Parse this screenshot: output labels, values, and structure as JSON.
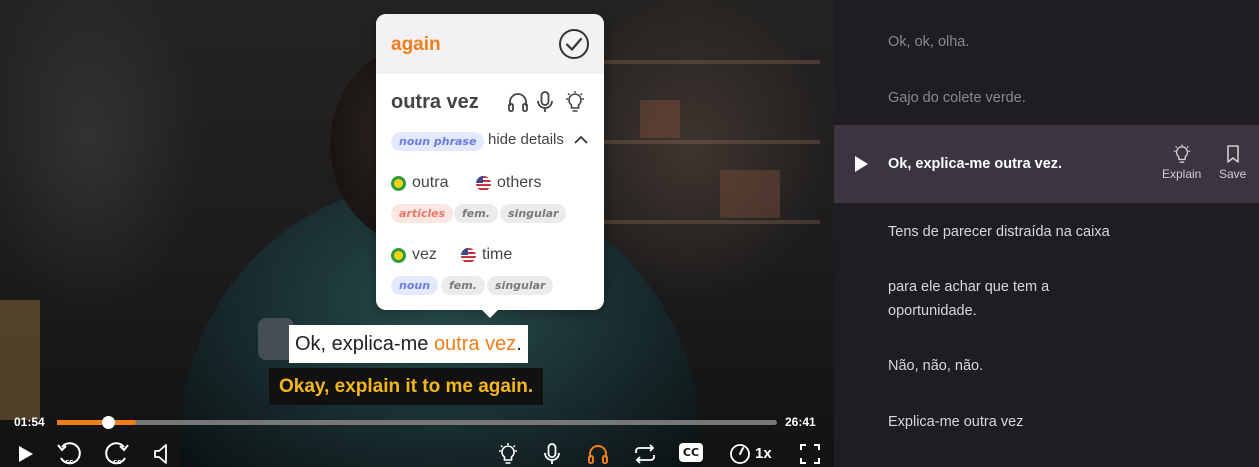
{
  "video": {
    "current_time": "01:54",
    "duration": "26:41",
    "progress": 0.071,
    "buffered": 0.11,
    "speed": "1x",
    "cc_label": "CC"
  },
  "popup": {
    "word": "again",
    "phrase": "outra vez",
    "phrase_type": "noun phrase",
    "details_toggle": "hide details",
    "words": [
      {
        "pt": "outra",
        "en": "others",
        "tags": [
          "articles",
          "fem.",
          "singular"
        ]
      },
      {
        "pt": "vez",
        "en": "time",
        "tags": [
          "noun",
          "fem.",
          "singular"
        ]
      }
    ]
  },
  "subtitles": {
    "pt_prefix": "Ok, explica-me ",
    "pt_highlight": "outra vez",
    "pt_suffix": ".",
    "en": "Okay, explain it to me again."
  },
  "transcript": {
    "lines": [
      "Ok, ok, olha.",
      "Gajo do colete verde.",
      "Ok, explica-me outra vez.",
      "Tens de parecer distraída na caixa",
      "para ele achar que tem a oportunidade.",
      "Não, não, não.",
      "Explica-me outra vez"
    ],
    "active_index": 2,
    "explain_label": "Explain",
    "save_label": "Save"
  },
  "colors": {
    "accent": "#f07c1a",
    "subtitle_en": "#f5b61a",
    "panel_bg": "#1f1c22",
    "active_row_bg": "#3a3540"
  }
}
